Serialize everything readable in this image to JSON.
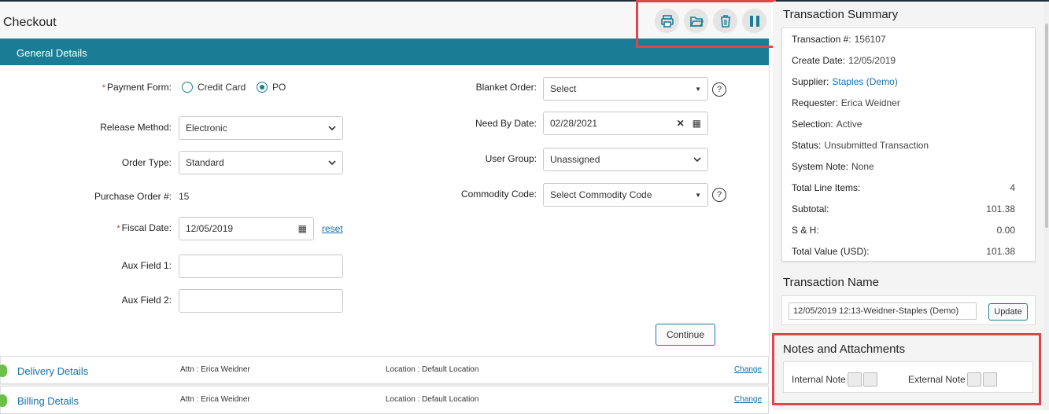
{
  "page": {
    "title": "Checkout"
  },
  "toolbar": {
    "icons": [
      "print-icon",
      "folder-open-icon",
      "trash-icon",
      "pause-icon"
    ]
  },
  "general": {
    "section_title": "General Details",
    "payment_form": {
      "label": "Payment Form:",
      "options": [
        "Credit Card",
        "PO"
      ],
      "selected": "PO"
    },
    "release_method": {
      "label": "Release Method:",
      "value": "Electronic"
    },
    "order_type": {
      "label": "Order Type:",
      "value": "Standard"
    },
    "po_number": {
      "label": "Purchase Order #:",
      "value": "15"
    },
    "fiscal_date": {
      "label": "Fiscal Date:",
      "value": "12/05/2019",
      "reset": "reset"
    },
    "aux1": {
      "label": "Aux Field 1:",
      "value": ""
    },
    "aux2": {
      "label": "Aux Field 2:",
      "value": ""
    },
    "blanket_order": {
      "label": "Blanket Order:",
      "value": "Select"
    },
    "need_by_date": {
      "label": "Need By Date:",
      "value": "02/28/2021"
    },
    "user_group": {
      "label": "User Group:",
      "value": "Unassigned"
    },
    "commodity_code": {
      "label": "Commodity Code:",
      "value": "Select Commodity Code"
    },
    "continue_label": "Continue",
    "help": "?"
  },
  "delivery": {
    "title": "Delivery Details",
    "attn": "Attn : Erica Weidner",
    "location": "Location : Default Location",
    "change": "Change"
  },
  "billing": {
    "title": "Billing Details",
    "attn": "Attn : Erica Weidner",
    "location": "Location : Default Location",
    "change": "Change"
  },
  "summary": {
    "heading": "Transaction Summary",
    "transaction": {
      "label": "Transaction #:",
      "value": "156107"
    },
    "create_date": {
      "label": "Create Date:",
      "value": "12/05/2019"
    },
    "supplier": {
      "label": "Supplier:",
      "value": "Staples (Demo)"
    },
    "requester": {
      "label": "Requester:",
      "value": "Erica Weidner"
    },
    "selection": {
      "label": "Selection:",
      "value": "Active"
    },
    "status": {
      "label": "Status:",
      "value": "Unsubmitted Transaction"
    },
    "system_note": {
      "label": "System Note:",
      "value": "None"
    },
    "total_line_items": {
      "label": "Total Line Items:",
      "value": "4"
    },
    "subtotal": {
      "label": "Subtotal:",
      "value": "101.38"
    },
    "sh": {
      "label": "S & H:",
      "value": "0.00"
    },
    "total_value": {
      "label": "Total Value (USD):",
      "value": "101.38"
    }
  },
  "transaction_name": {
    "heading": "Transaction Name",
    "value": "12/05/2019 12:13-Weidner-Staples (Demo)",
    "update_label": "Update"
  },
  "notes": {
    "heading": "Notes and Attachments",
    "internal": "Internal Note",
    "external": "External Note"
  },
  "colors": {
    "accent": "#1a7d95",
    "highlight": "#e0454d",
    "link": "#1a6fa8",
    "status_green": "#6cc04a"
  }
}
